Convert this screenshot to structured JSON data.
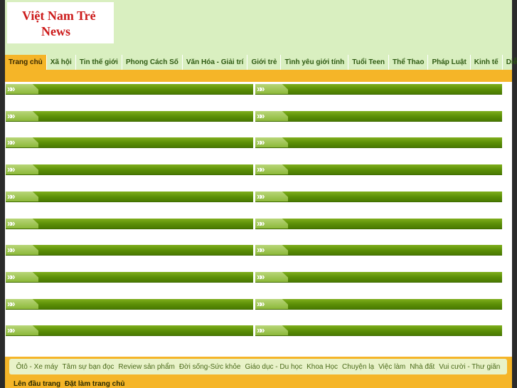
{
  "logo": {
    "line1": "Việt Nam Trẻ",
    "line2": "News"
  },
  "nav": [
    {
      "label": "Trang chủ",
      "active": true
    },
    {
      "label": "Xã hội"
    },
    {
      "label": "Tin thế giới"
    },
    {
      "label": "Phong Cách Số"
    },
    {
      "label": "Văn Hóa - Giải trí"
    },
    {
      "label": "Giới trẻ"
    },
    {
      "label": "Tình yêu giới tính"
    },
    {
      "label": "Tuổi Teen"
    },
    {
      "label": "Thể Thao"
    },
    {
      "label": "Pháp Luật"
    },
    {
      "label": "Kinh tế"
    },
    {
      "label": "Diễn đàn"
    }
  ],
  "category_rows": 10,
  "footer_links": [
    "Ôtô - Xe máy",
    "Tâm sự bạn đọc",
    "Review sản phẩm",
    "Đời sống-Sức khỏe",
    "Giáo dục - Du học",
    "Khoa Học",
    "Chuyện lạ",
    "Việc làm",
    "Nhà đất",
    "Vui cười - Thư giãn"
  ],
  "bottom_links": {
    "top": "Lên đầu trang",
    "home": "Đặt làm trang chủ"
  },
  "colors": {
    "accent": "#f5b528",
    "header_bg": "#d9efc0",
    "bar_green": "#5a8e06",
    "logo_red": "#cc1a1a"
  }
}
